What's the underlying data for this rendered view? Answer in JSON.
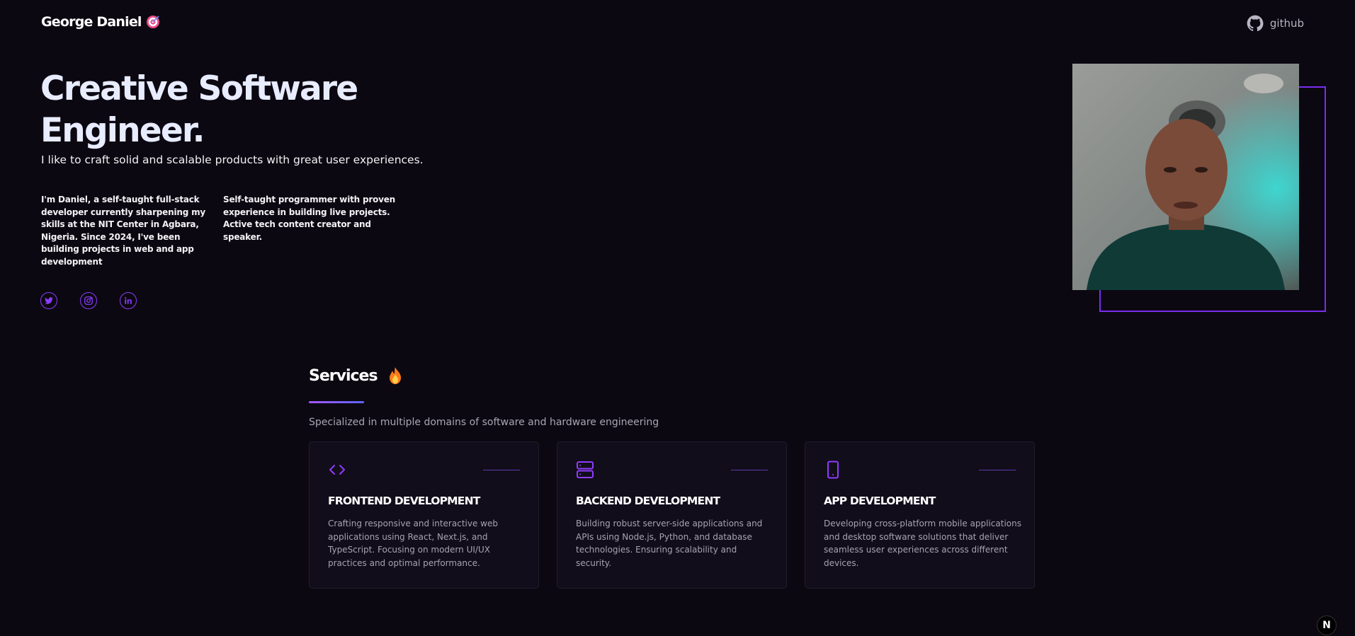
{
  "header": {
    "brand": "George Daniel",
    "github_label": "github"
  },
  "hero": {
    "title": "Creative Software Engineer.",
    "subtitle": "I like to craft solid and scalable products with great user experiences.",
    "bio_left": "I'm Daniel, a self-taught full-stack developer currently sharpening my skills at the NIT Center in Agbara, Nigeria. Since 2024, I've been building projects in web and app development",
    "bio_right": "Self-taught programmer with proven experience in building live projects. Active tech content creator and speaker.",
    "socials": [
      "twitter-icon",
      "instagram-icon",
      "linkedin-icon"
    ]
  },
  "services": {
    "title": "Services",
    "description": "Specialized in multiple domains of software and hardware engineering",
    "cards": [
      {
        "icon": "code-icon",
        "title": "FRONTEND DEVELOPMENT",
        "text": "Crafting responsive and interactive web applications using React, Next.js, and TypeScript. Focusing on modern UI/UX practices and optimal performance."
      },
      {
        "icon": "server-icon",
        "title": "BACKEND DEVELOPMENT",
        "text": "Building robust server-side applications and APIs using Node.js, Python, and database technologies. Ensuring scalability and security."
      },
      {
        "icon": "mobile-icon",
        "title": "APP DEVELOPMENT",
        "text": "Developing cross-platform mobile applications and desktop software solutions that deliver seamless user experiences across different devices."
      }
    ]
  },
  "next_badge": "N",
  "colors": {
    "background": "#0c0811",
    "accent": "#8b3dff",
    "card": "#110d1a"
  }
}
